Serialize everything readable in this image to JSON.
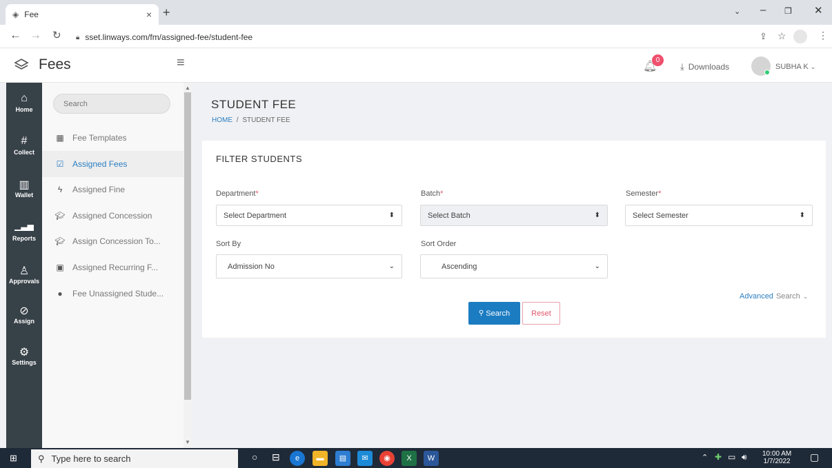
{
  "browser": {
    "tab_title": "Fee",
    "url": "sset.linways.com/fm/assigned-fee/student-fee"
  },
  "header": {
    "app_name": "Fees",
    "notification_count": "0",
    "downloads_label": "Downloads",
    "user_name": "SUBHA K",
    "online_color": "#2ecc71"
  },
  "icon_nav": [
    {
      "label": "Home",
      "icon": "home-icon"
    },
    {
      "label": "Collect",
      "icon": "hash-icon"
    },
    {
      "label": "Wallet",
      "icon": "wallet-icon"
    },
    {
      "label": "Reports",
      "icon": "bar-chart-icon"
    },
    {
      "label": "Approvals",
      "icon": "user-check-icon"
    },
    {
      "label": "Assign",
      "icon": "check-circle-icon"
    },
    {
      "label": "Settings",
      "icon": "gear-icon"
    }
  ],
  "sidebar": {
    "search_placeholder": "Search",
    "items": [
      {
        "label": "Fee Templates",
        "icon": "grid-icon",
        "active": false
      },
      {
        "label": "Assigned Fees",
        "icon": "checkbox-icon",
        "active": true
      },
      {
        "label": "Assigned Fine",
        "icon": "bolt-icon",
        "active": false
      },
      {
        "label": "Assigned Concession",
        "icon": "graduation-cap-icon",
        "active": false
      },
      {
        "label": "Assign Concession To...",
        "icon": "graduation-cap-icon",
        "active": false
      },
      {
        "label": "Assigned Recurring F...",
        "icon": "calendar-plus-icon",
        "active": false
      },
      {
        "label": "Fee Unassigned Stude...",
        "icon": "user-icon",
        "active": false
      }
    ]
  },
  "page": {
    "title": "STUDENT FEE",
    "breadcrumb_home": "HOME",
    "breadcrumb_sep": "/",
    "breadcrumb_current": "STUDENT FEE"
  },
  "filter": {
    "title": "FILTER STUDENTS",
    "department_label": "Department",
    "department_value": "Select Department",
    "batch_label": "Batch",
    "batch_value": "Select Batch",
    "semester_label": "Semester",
    "semester_value": "Select Semester",
    "sort_by_label": "Sort By",
    "sort_by_value": "Admission No",
    "sort_order_label": "Sort Order",
    "sort_order_value": "Ascending",
    "required_mark": "*",
    "advanced_1": "Advanced",
    "advanced_2": "Search",
    "search_button": "Search",
    "reset_button": "Reset",
    "accent_color": "#1c7cc1"
  },
  "taskbar": {
    "search_placeholder": "Type here to search",
    "time": "10:00 AM",
    "date": "1/7/2022"
  }
}
